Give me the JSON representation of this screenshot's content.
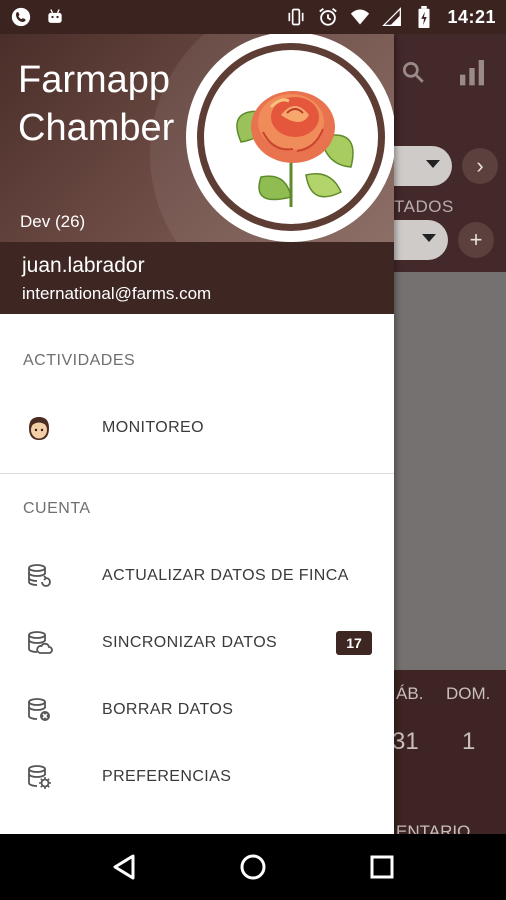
{
  "status_bar": {
    "time": "14:21",
    "left_icons": [
      "phone-icon",
      "android-icon"
    ],
    "right_icons": [
      "vibrate-icon",
      "alarm-icon",
      "wifi-icon",
      "signal-icon",
      "battery-charging-icon"
    ]
  },
  "drawer": {
    "app_title_line1": "Farmapp",
    "app_title_line2": "Chamber",
    "version": "Dev (26)",
    "username": "juan.labrador",
    "email": "international@farms.com",
    "sections": {
      "activities_label": "ACTIVIDADES",
      "account_label": "CUENTA"
    },
    "activities": [
      {
        "label": "MONITOREO",
        "icon": "monitor-person-icon"
      }
    ],
    "account_items": [
      {
        "label": "ACTUALIZAR DATOS DE FINCA",
        "icon": "database-refresh-icon"
      },
      {
        "label": "SINCRONIZAR DATOS",
        "icon": "database-cloud-icon",
        "badge": "17"
      },
      {
        "label": "BORRAR DATOS",
        "icon": "database-delete-icon"
      },
      {
        "label": "PREFERENCIAS",
        "icon": "database-settings-icon"
      }
    ]
  },
  "background": {
    "partial_label": "TADOS",
    "day_sat": "ÁB.",
    "day_sun": "DOM.",
    "num_sat": "31",
    "num_sun": "1",
    "partial_bottom": "ENTARIO"
  },
  "colors": {
    "brand_dark": "#3e2723",
    "header_gradient_start": "#4a2e29",
    "text_primary": "#3a3a3a",
    "text_secondary": "#6f6f6f"
  }
}
